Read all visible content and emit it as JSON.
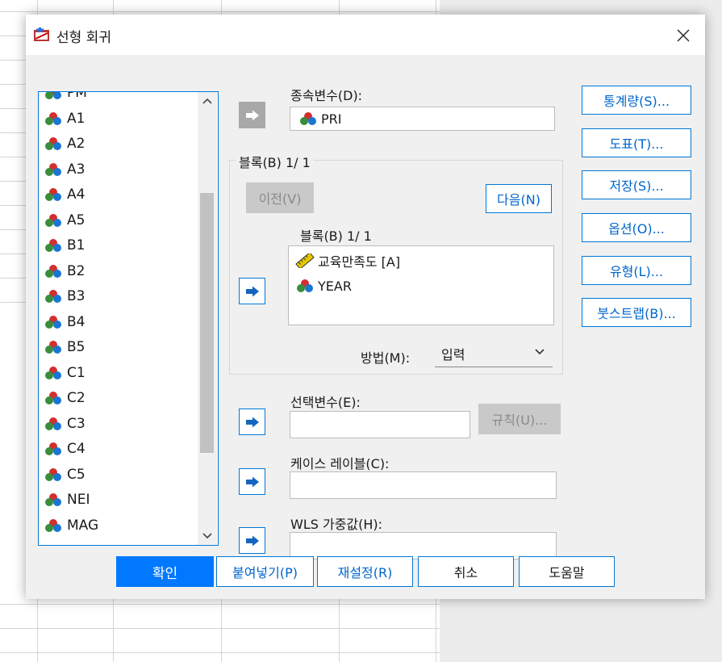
{
  "window": {
    "title": "선형 회귀",
    "close_glyph": "✕"
  },
  "variables": {
    "items": [
      {
        "name": "PM"
      },
      {
        "name": "A1"
      },
      {
        "name": "A2"
      },
      {
        "name": "A3"
      },
      {
        "name": "A4"
      },
      {
        "name": "A5"
      },
      {
        "name": "B1"
      },
      {
        "name": "B2"
      },
      {
        "name": "B3"
      },
      {
        "name": "B4"
      },
      {
        "name": "B5"
      },
      {
        "name": "C1"
      },
      {
        "name": "C2"
      },
      {
        "name": "C3"
      },
      {
        "name": "C4"
      },
      {
        "name": "C5"
      },
      {
        "name": "NEI"
      },
      {
        "name": "MAG"
      }
    ],
    "item_icon": "nominal-variable-icon"
  },
  "dependent": {
    "label": "종속변수(D):",
    "value": "PRI",
    "icon": "nominal-variable-icon"
  },
  "block": {
    "group_title": "블록(B) 1/ 1",
    "prev_label": "이전(V)",
    "next_label": "다음(N)",
    "list_title": "블록(B) 1/ 1",
    "independents": [
      {
        "name": "교육만족도 [A]",
        "icon": "scale-variable-icon"
      },
      {
        "name": "YEAR",
        "icon": "nominal-variable-icon"
      }
    ],
    "method_label": "방법(M):",
    "method_value": "입력"
  },
  "selection": {
    "label": "선택변수(E):",
    "value": "",
    "rule_label": "규칙(U)..."
  },
  "case_label": {
    "label": "케이스 레이블(C):",
    "value": ""
  },
  "wls": {
    "label": "WLS 가중값(H):",
    "value": ""
  },
  "side_buttons": {
    "statistics": "통계량(S)...",
    "plots": "도표(T)...",
    "save": "저장(S)...",
    "options": "옵션(O)...",
    "style": "유형(L)...",
    "bootstrap": "붓스트랩(B)..."
  },
  "bottom_buttons": {
    "ok": "확인",
    "paste": "붙여넣기(P)",
    "reset": "재설정(R)",
    "cancel": "취소",
    "help": "도움말"
  },
  "colors": {
    "accent": "#0078d7",
    "primary_button": "#0078ff",
    "disabled_button": "#c9c9c9",
    "nominal_red": "#d32f2f",
    "nominal_green": "#388e3c",
    "nominal_blue": "#1976d2",
    "scale_ruler": "#d4b400"
  }
}
